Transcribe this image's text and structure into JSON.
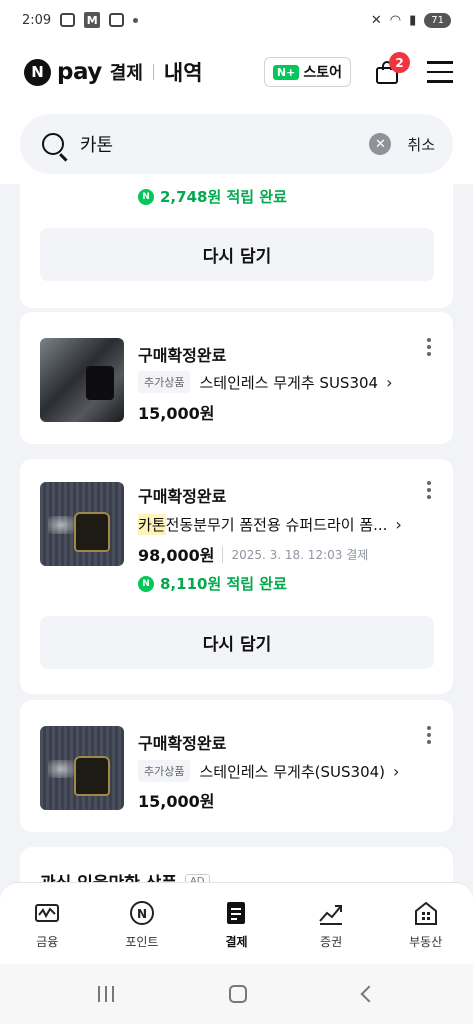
{
  "status_bar": {
    "time": "2:09",
    "battery": "71"
  },
  "header": {
    "brand": "pay",
    "brand_sub": "결제",
    "section": "내역",
    "store_label": "스토어",
    "store_badge": "N+",
    "cart_count": "2"
  },
  "search": {
    "query": "카톤",
    "cancel_label": "취소"
  },
  "cards": [
    {
      "reward": "2,748원 적립 완료",
      "again_label": "다시 담기"
    },
    {
      "status": "구매확정완료",
      "tag": "추가상품",
      "name": "스테인레스 무게추 SUS304",
      "price": "15,000원"
    },
    {
      "status": "구매확정완료",
      "highlight": "카톤",
      "name": " 전동분무기 폼전용 슈퍼드라이 폼...",
      "price": "98,000원",
      "date": "2025. 3. 18. 12:03 결제",
      "reward": "8,110원 적립 완료",
      "again_label": "다시 담기"
    },
    {
      "status": "구매확정완료",
      "tag": "추가상품",
      "name": "스테인레스 무게추(SUS304)",
      "price": "15,000원"
    }
  ],
  "ad_section": {
    "title": "관심 있을만한 상품",
    "badge": "AD"
  },
  "bottom_nav": [
    {
      "label": "금융",
      "icon": "finance-icon"
    },
    {
      "label": "포인트",
      "icon": "point-icon"
    },
    {
      "label": "결제",
      "icon": "payment-icon",
      "active": true
    },
    {
      "label": "증권",
      "icon": "stock-icon"
    },
    {
      "label": "부동산",
      "icon": "realestate-icon"
    }
  ],
  "colors": {
    "reward_green": "#03a94e",
    "badge_red": "#f5333f",
    "highlight": "#fff4b8"
  }
}
